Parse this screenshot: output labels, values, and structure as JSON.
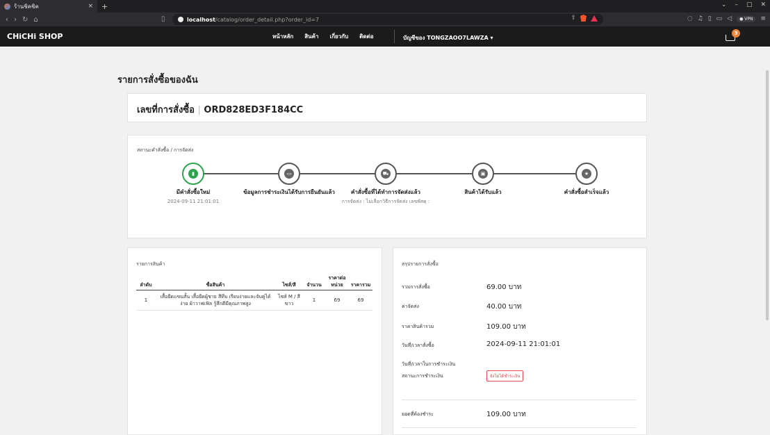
{
  "browser": {
    "tab_title": "ร้านชิคชิค",
    "tab_close": "×",
    "new_tab": "+",
    "url_host": "localhost",
    "url_path": "/catalog/order_detail.php?order_id=7",
    "window_controls": [
      "⌄",
      "–",
      "▢",
      "✕"
    ],
    "nav_buttons": [
      "‹",
      "›",
      "↻",
      "⌂"
    ],
    "vpn_label": "● VPN"
  },
  "header": {
    "brand": "CHiCHi SHOP",
    "menu": [
      "หน้าหลัก",
      "สินค้า",
      "เกี่ยวกับ",
      "ติดต่อ"
    ],
    "account": "บัญชีของ TONGZAOO7LAWZA",
    "account_caret": "▾",
    "cart_count": "3"
  },
  "page": {
    "title": "รายการสั่งซื้อของฉัน",
    "order_label": "เลขที่การสั่งซื้อ",
    "order_sep": "|",
    "order_number": "ORD828ED3F184CC"
  },
  "status": {
    "label": "สถานะคำสั่งซื้อ / การจัดส่ง",
    "steps": [
      {
        "label": "มีคำสั่งซื้อใหม่",
        "sub": "2024-09-11 21:01:01",
        "done": true,
        "icon": "▮"
      },
      {
        "label": "ข้อมูลการชำระเงินได้รับการยืนยันแล้ว",
        "sub": "",
        "done": false,
        "icon": "▭"
      },
      {
        "label": "คำสั่งซื้อที่ได้ทำการจัดส่งแล้ว",
        "sub": "การจัดส่ง : ไม่เลือกวิธีการจัดส่ง เลขพัสดุ :",
        "done": false,
        "icon": "⛟"
      },
      {
        "label": "สินค้าได้รับแล้ว",
        "sub": "",
        "done": false,
        "icon": "▣"
      },
      {
        "label": "คำสั่งซื้อสำเร็จแล้ว",
        "sub": "",
        "done": false,
        "icon": "★"
      }
    ]
  },
  "items": {
    "label": "รายการสินค้า",
    "headers": [
      "ลำดับ",
      "ชื่อสินค้า",
      "ไซส์/สี",
      "จำนวน",
      "ราคาต่อหน่วย",
      "ราคารวม"
    ],
    "rows": [
      [
        "1",
        "เสื้อยืดแขนสั้น เสื้อยืดผู้ชาย สีทึบ เรียบง่ายและจับคู่ได้ง่าย ผ้าวาฟเฟิล รู้สึกดีมีคุณภาพสูง",
        "ไซส์ M / สีขาว",
        "1",
        "69",
        "69"
      ]
    ]
  },
  "summary": {
    "label": "สรุปรายการสั่งซื้อ",
    "rows": [
      {
        "label": "รวมการสั่งซื้อ",
        "value": "69.00 บาท"
      },
      {
        "label": "ค่าจัดส่ง",
        "value": "40.00 บาท"
      },
      {
        "label": "ราคาสินค้ารวม",
        "value": "109.00 บาท"
      },
      {
        "label": "วันที่/เวลาสั่งซื้อ",
        "value": "2024-09-11 21:01:01"
      },
      {
        "label": "วันที่/เวลาในการชำระเงิน",
        "value": ""
      }
    ],
    "payment_status_label": "สถานะการชำระเงิน",
    "payment_status_value": "ยังไม่ได้ชำระเงิน",
    "total_label": "ยอดที่ต้องชำระ",
    "total_value": "109.00 บาท"
  }
}
